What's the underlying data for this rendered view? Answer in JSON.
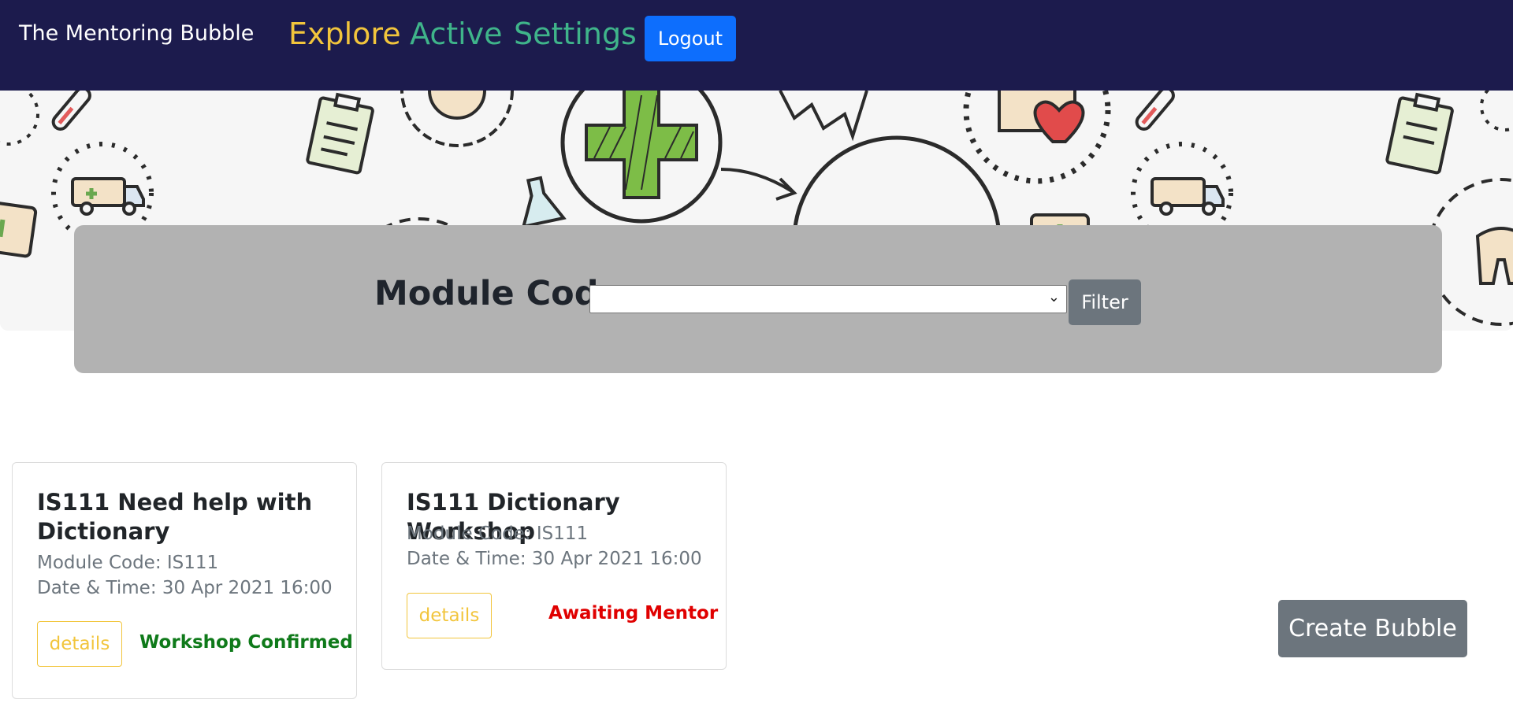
{
  "nav": {
    "brand": "The Mentoring Bubble",
    "links": [
      {
        "label": "Explore",
        "color": "#f2c53c"
      },
      {
        "label": "Active",
        "color": "#3fb48a"
      },
      {
        "label": "Settings",
        "color": "#3fb48a"
      }
    ],
    "logout_label": "Logout",
    "background": "#1c1b4d"
  },
  "filter": {
    "label": "Module Code:",
    "selected_value": "",
    "button_label": "Filter"
  },
  "bubbles": [
    {
      "title": "IS111 Need help with Dictionary",
      "module": "Module Code: IS111",
      "datetime": "Date & Time: 30 Apr 2021 16:00",
      "details_label": "details",
      "status": "Workshop Confirmed",
      "status_color": "#0f7a1a"
    },
    {
      "title": "IS111 Dictionary Workshop",
      "module": "Module Code: IS111",
      "datetime": "Date & Time: 30 Apr 2021 16:00",
      "details_label": "details",
      "status": "Awaiting Mentor",
      "status_color": "#e00000"
    }
  ],
  "create_label": "Create Bubble"
}
